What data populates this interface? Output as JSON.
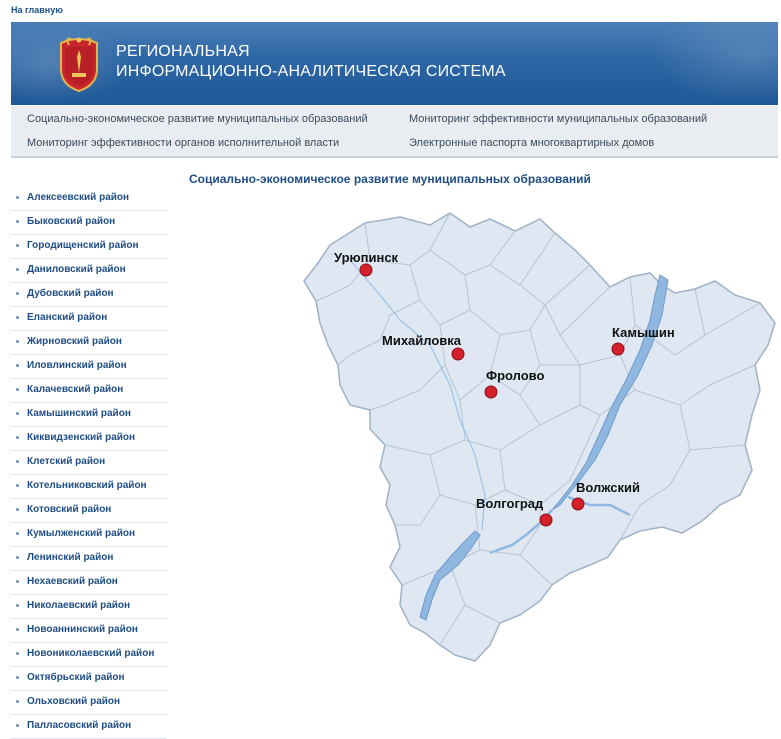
{
  "top_link": "На главную",
  "banner": {
    "title_line1": "РЕГИОНАЛЬНАЯ",
    "title_line2": "ИНФОРМАЦИОННО-АНАЛИТИЧЕСКАЯ СИСТЕМА"
  },
  "nav": {
    "items": [
      "Социально-экономическое развитие муниципальных образований",
      "Мониторинг эффективности муниципальных образований",
      "Мониторинг эффективности органов исполнительной власти",
      "Электронные паспорта многоквартирных домов"
    ]
  },
  "sidebar": {
    "items": [
      "Алексеевский район",
      "Быковский район",
      "Городищенский район",
      "Даниловский район",
      "Дубовский район",
      "Еланский район",
      "Жирновский район",
      "Иловлинский район",
      "Калачевский район",
      "Камышинский район",
      "Киквидзенский район",
      "Клетский район",
      "Котельниковский район",
      "Котовский район",
      "Кумылженский район",
      "Ленинский район",
      "Нехаевский район",
      "Николаевский район",
      "Новоаннинский район",
      "Новониколаевский район",
      "Октябрьский район",
      "Ольховский район",
      "Палласовский район"
    ]
  },
  "content_title": "Социально-экономическое развитие муниципальных образований",
  "map": {
    "cities": [
      "Урюпинск",
      "Михайловка",
      "Фролово",
      "Камышин",
      "Волжский",
      "Волгоград"
    ],
    "colors": {
      "region_fill": "#dfe8f2",
      "border": "#9fb1c5",
      "water": "#8fb7e0",
      "marker": "#d4202a"
    }
  }
}
